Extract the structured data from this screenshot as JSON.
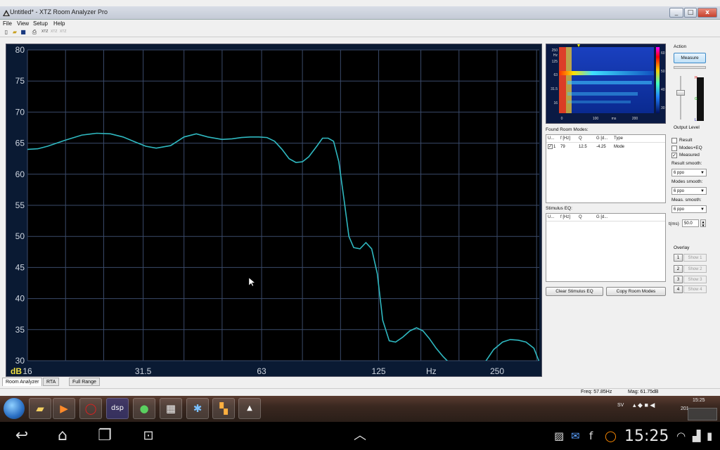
{
  "window": {
    "title": "Untitled* - XTZ Room Analyzer Pro",
    "controls": {
      "minimize": "_",
      "maximize": "□",
      "close": "x"
    }
  },
  "menu": [
    "File",
    "View",
    "Setup",
    "Help"
  ],
  "toolbar": {
    "icons": [
      "new-icon",
      "open-icon",
      "save-icon",
      "print-icon",
      "xtz-stim-icon",
      "xtz-rta-icon",
      "xtz-seq-icon"
    ],
    "labels": [
      "XTZ",
      "XTZ",
      "XTZ"
    ]
  },
  "graph": {
    "y_ticks": [
      "80",
      "75",
      "70",
      "65",
      "60",
      "55",
      "50",
      "45",
      "40",
      "35",
      "30"
    ],
    "y_unit": "dB",
    "x_ticks": [
      "16",
      "31.5",
      "63",
      "125",
      "Hz",
      "250"
    ],
    "colors": {
      "bg": "#000000",
      "grid": "#3a4a6a",
      "curve": "#2fb8c0",
      "axis_text": "#cfd6e0",
      "unit": "#f0e040"
    }
  },
  "chart_data": {
    "type": "line",
    "xlabel": "Hz",
    "ylabel": "dB",
    "xscale": "log",
    "xlim": [
      16,
      320
    ],
    "ylim": [
      30,
      80
    ],
    "x": [
      16,
      17,
      18,
      20,
      22,
      24,
      26,
      28,
      30,
      32,
      34,
      37,
      40,
      43,
      46,
      50,
      53,
      56,
      59,
      62,
      65,
      68,
      71,
      74,
      77,
      80,
      83,
      87,
      90,
      93,
      96,
      99,
      102,
      105,
      108,
      112,
      116,
      120,
      124,
      128,
      133,
      138,
      144,
      150,
      156,
      162,
      168,
      175,
      182,
      190,
      200,
      210,
      220,
      232,
      245,
      258,
      270,
      283,
      296,
      310,
      320
    ],
    "y": [
      64.0,
      64.1,
      64.5,
      65.5,
      66.3,
      66.6,
      66.5,
      66.0,
      65.2,
      64.5,
      64.2,
      64.6,
      66.0,
      66.5,
      66.0,
      65.6,
      65.7,
      65.9,
      66.0,
      66.0,
      65.9,
      65.3,
      64.0,
      62.5,
      61.9,
      62.0,
      62.8,
      64.5,
      65.8,
      65.8,
      65.3,
      62.0,
      56.0,
      50.0,
      48.2,
      48.0,
      49.0,
      48.0,
      44.0,
      36.5,
      33.2,
      33.0,
      33.8,
      34.8,
      35.3,
      34.8,
      33.6,
      32.0,
      30.7,
      29.5,
      28.2,
      27.6,
      28.0,
      29.6,
      31.8,
      33.0,
      33.4,
      33.3,
      33.0,
      32.0,
      29.8
    ]
  },
  "spectrogram": {
    "y_labels": [
      "250",
      "Hz",
      "125",
      "63",
      "31.5",
      "16"
    ],
    "x_labels": [
      "0",
      "100",
      "ms",
      "200"
    ],
    "colorbar_labels": [
      "60",
      "50",
      "40",
      "30"
    ]
  },
  "room_modes": {
    "title": "Found Room Modes:",
    "columns": [
      "U...",
      "f [Hz]",
      "Q",
      "G [d...",
      "Type"
    ],
    "rows": [
      {
        "checked": "✓",
        "num": "1",
        "f": "79",
        "q": "12.5",
        "g": "-4.25",
        "type": "Mode"
      }
    ]
  },
  "stimulus_eq": {
    "title": "Stimulus EQ:",
    "columns": [
      "U...",
      "f [Hz]",
      "Q",
      "G [d..."
    ]
  },
  "buttons": {
    "clear": "Clear Stimulus EQ",
    "copy": "Copy Room Modes"
  },
  "action": {
    "title": "Action",
    "measure": "Measure",
    "output_level": "Output Level",
    "meter_h": "H",
    "meter_g": "G",
    "meter_l": "L"
  },
  "options": {
    "result": "Result",
    "modes_eq": "Modes+EQ",
    "measured": "Measured",
    "result_smooth": "Result smooth:",
    "result_smooth_val": "6 ppo",
    "modes_smooth": "Modes smooth:",
    "modes_smooth_val": "6 ppo",
    "meas_smooth": "Meas. smooth:",
    "meas_smooth_val": "6 ppo",
    "t_label": "t(ms)",
    "t_val": "50.0"
  },
  "overlay": {
    "title": "Overlay",
    "nums": [
      "1",
      "2",
      "3",
      "4"
    ],
    "shows": [
      "Show 1",
      "Show 2",
      "Show 3",
      "Show 4"
    ]
  },
  "tabs": [
    "Room Analyzer",
    "RTA",
    "Full Range"
  ],
  "status": {
    "freq": "Freq: 57.85Hz",
    "mag": "Mag: 61.75dB"
  },
  "taskbar": {
    "apps": [
      "explorer-icon",
      "media-player-icon",
      "opera-icon",
      "dsp-icon",
      "spotify-icon",
      "calculator-icon",
      "network-icon",
      "office-icon",
      "xtz-icon"
    ],
    "dsp_label": "dsp",
    "lang": "SV",
    "time": "15:25",
    "date": "201"
  },
  "android": {
    "time": "15:25"
  }
}
